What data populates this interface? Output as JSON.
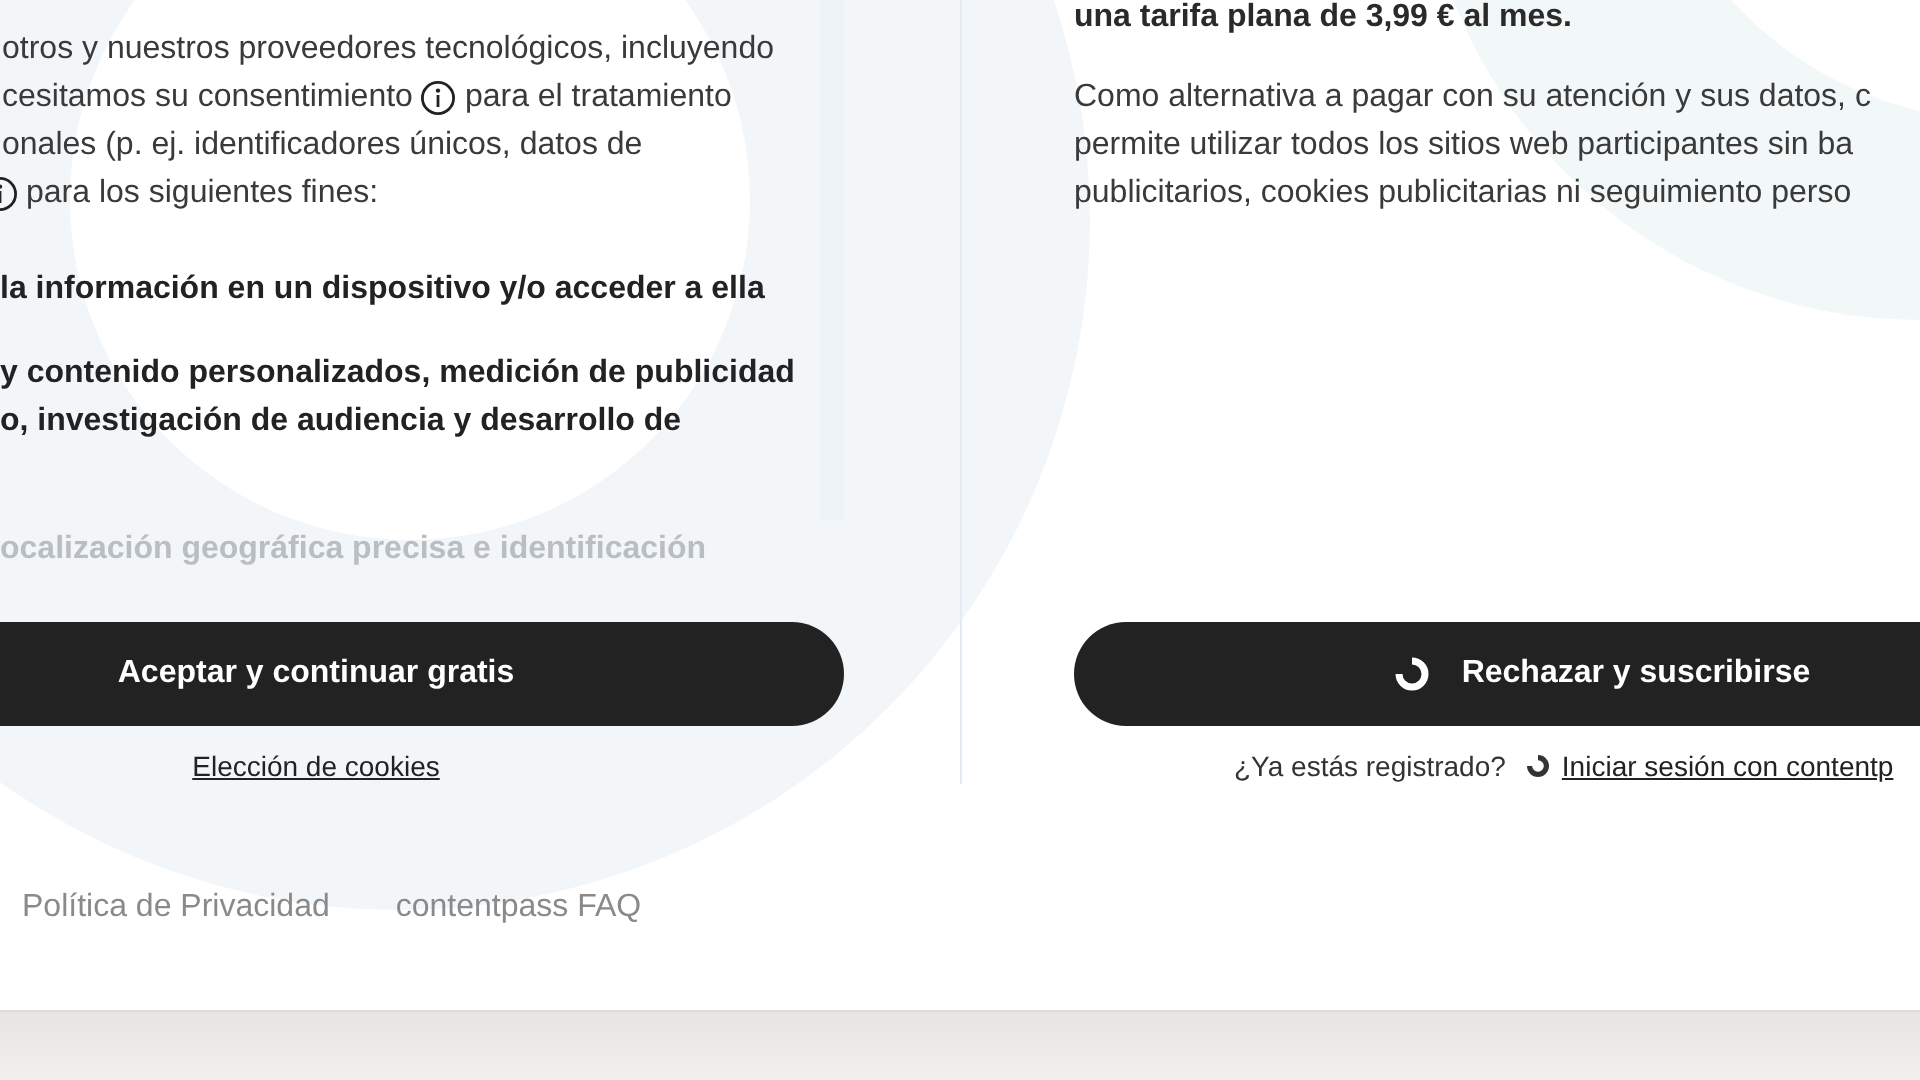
{
  "left_panel": {
    "intro_lines": [
      {
        "segments": [
          {
            "kind": "text",
            "text": "otros y nuestros proveedores tecnológicos, incluyendo"
          }
        ]
      },
      {
        "segments": [
          {
            "kind": "text",
            "text": "cesitamos su consentimiento"
          },
          {
            "kind": "info"
          },
          {
            "kind": "text",
            "text": "para el tratamiento"
          }
        ]
      },
      {
        "segments": [
          {
            "kind": "text",
            "text": "onales (p. ej. identificadores únicos, datos de"
          }
        ]
      },
      {
        "segments": [
          {
            "kind": "info"
          },
          {
            "kind": "text",
            "text": "para los siguientes fines:"
          }
        ]
      }
    ],
    "purposes": [
      {
        "faded": false,
        "lines": [
          "la información en un dispositivo y/o acceder a ella"
        ]
      },
      {
        "faded": false,
        "lines": [
          "y contenido personalizados, medición de publicidad",
          "o, investigación de audiencia y desarrollo de"
        ]
      },
      {
        "faded": true,
        "lines": [
          "ocalización geográfica precisa e identificación"
        ]
      }
    ],
    "accept_button": "Aceptar y continuar gratis",
    "cookie_choice_link": "Elección de cookies"
  },
  "right_panel": {
    "price_line": "una tarifa plana de 3,99 € al mes.",
    "description_lines": [
      "Como alternativa a pagar con su atención y sus datos, c",
      "permite utilizar todos los sitios web participantes sin ba",
      "publicitarios, cookies publicitarias ni seguimiento perso"
    ],
    "reject_button": "Rechazar y suscribirse",
    "registered_prompt": "¿Ya estás registrado?",
    "login_link": "Iniciar sesión con contentp"
  },
  "footer_links": [
    "Política de Privacidad",
    "contentpass FAQ"
  ]
}
